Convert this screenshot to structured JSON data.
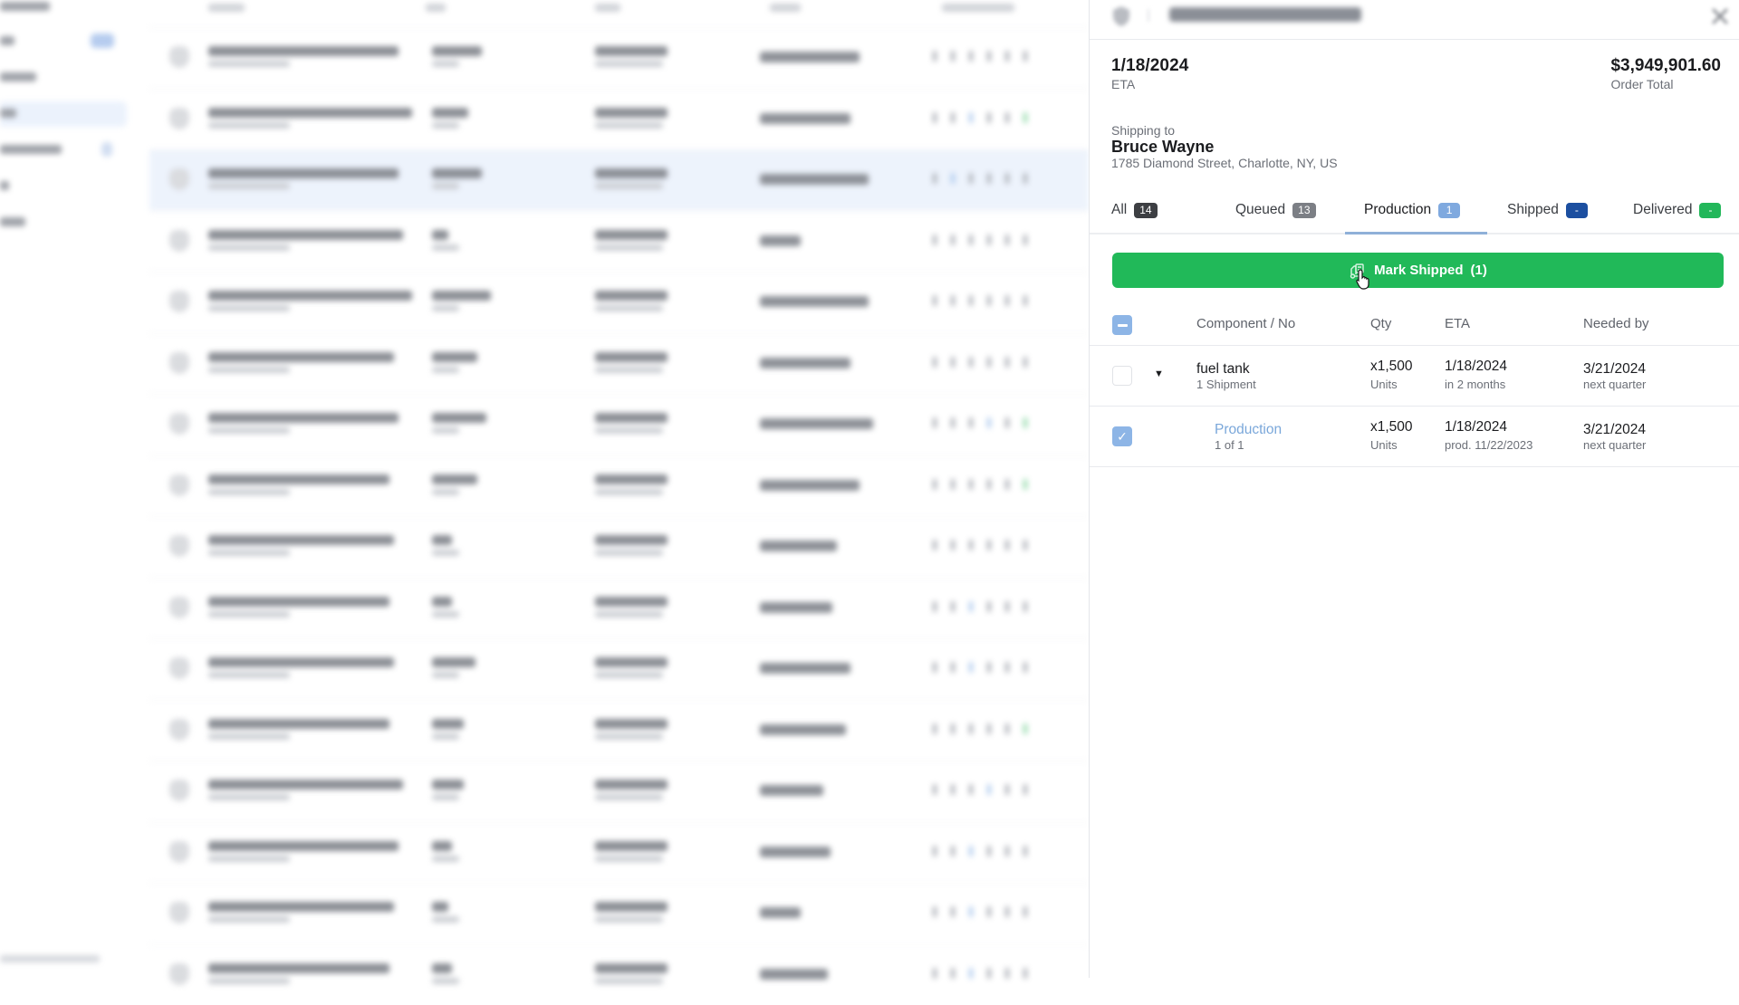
{
  "panel": {
    "header": {
      "order_icon": "shield-icon",
      "close_icon": "close-icon"
    },
    "eta": {
      "value": "1/18/2024",
      "label": "ETA"
    },
    "total": {
      "value": "$3,949,901.60",
      "label": "Order Total"
    },
    "shipping": {
      "label": "Shipping to",
      "name": "Bruce Wayne",
      "address": "1785 Diamond Street, Charlotte, NY, US"
    },
    "tabs": [
      {
        "label": "All",
        "count": "14",
        "color": "#3d3f43"
      },
      {
        "label": "Queued",
        "count": "13",
        "color": "#7c7f85"
      },
      {
        "label": "Production",
        "count": "1",
        "color": "#7fa9df",
        "active": true
      },
      {
        "label": "Shipped",
        "count": "-",
        "color": "#1c4fa0"
      },
      {
        "label": "Delivered",
        "count": "-",
        "color": "#22b75a"
      }
    ],
    "action_button": {
      "label": "Mark Shipped",
      "count": "(1)",
      "icon": "forklift-icon",
      "color": "#21b959"
    },
    "table": {
      "columns": [
        "Component / No",
        "Qty",
        "ETA",
        "Needed by"
      ],
      "rows": [
        {
          "checked": false,
          "expandable": true,
          "component": "fuel tank",
          "component_sub": "1 Shipment",
          "qty": "x1,500",
          "qty_unit": "Units",
          "eta": "1/18/2024",
          "eta_sub": "in 2 months",
          "needed_by": "3/21/2024",
          "needed_by_sub": "next quarter"
        },
        {
          "checked": true,
          "expandable": false,
          "component": "Production",
          "component_sub": "1 of 1",
          "qty": "x1,500",
          "qty_unit": "Units",
          "eta": "1/18/2024",
          "eta_sub": "prod. 11/22/2023",
          "needed_by": "3/21/2024",
          "needed_by_sub": "next quarter"
        }
      ]
    }
  },
  "background": {
    "blurred": true,
    "selected_row_index": 2,
    "row_count": 16
  }
}
